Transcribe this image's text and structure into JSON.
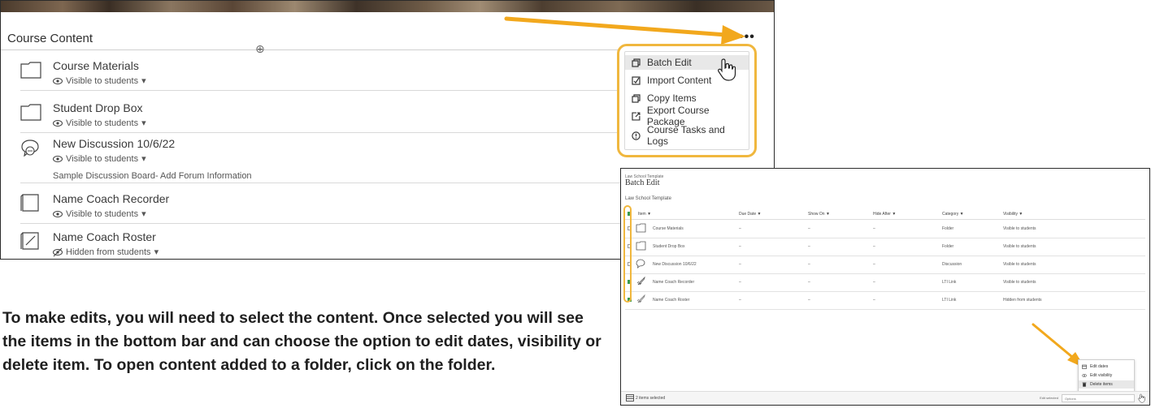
{
  "left": {
    "section_title": "Course Content",
    "items": [
      {
        "title": "Course Materials",
        "visibility": "Visible to students",
        "description": ""
      },
      {
        "title": "Student Drop Box",
        "visibility": "Visible to students",
        "description": ""
      },
      {
        "title": "New Discussion 10/6/22",
        "visibility": "Visible to students",
        "description": "Sample Discussion Board- Add Forum Information"
      },
      {
        "title": "Name Coach Recorder",
        "visibility": "Visible to students",
        "description": ""
      },
      {
        "title": "Name Coach Roster",
        "visibility": "Hidden from students",
        "description": ""
      }
    ],
    "menu": [
      {
        "label": "Batch Edit",
        "icon": "batch-edit-icon"
      },
      {
        "label": "Import Content",
        "icon": "import-icon"
      },
      {
        "label": "Copy Items",
        "icon": "copy-icon"
      },
      {
        "label": "Export Course Package",
        "icon": "export-icon"
      },
      {
        "label": "Course Tasks and Logs",
        "icon": "info-icon"
      }
    ],
    "more_label": "•••"
  },
  "right": {
    "crumb": "Law School Template",
    "title": "Batch Edit",
    "subtitle": "Law School Template",
    "columns": [
      "Item ▼",
      "Due Date ▼",
      "Show On ▼",
      "Hide After ▼",
      "Category ▼",
      "Visibility ▼"
    ],
    "rows": [
      {
        "item": "Course Materials",
        "due": "–",
        "show": "–",
        "hide": "–",
        "category": "Folder",
        "visibility": "Visible to students",
        "checked": false
      },
      {
        "item": "Student Drop Box",
        "due": "–",
        "show": "–",
        "hide": "–",
        "category": "Folder",
        "visibility": "Visible to students",
        "checked": false
      },
      {
        "item": "New Discussion 10/6/22",
        "due": "–",
        "show": "–",
        "hide": "–",
        "category": "Discussion",
        "visibility": "Visible to students",
        "checked": false
      },
      {
        "item": "Name Coach Recorder",
        "due": "–",
        "show": "–",
        "hide": "–",
        "category": "LTI Link",
        "visibility": "Visible to students",
        "checked": true
      },
      {
        "item": "Name Coach Roster",
        "due": "–",
        "show": "–",
        "hide": "–",
        "category": "LTI Link",
        "visibility": "Hidden from students",
        "checked": true
      }
    ],
    "selected_text": "2 items selected",
    "edit_label": "Edit selected",
    "select_placeholder": "Options",
    "options": [
      "Edit dates",
      "Edit visibility",
      "Delete items"
    ]
  },
  "instructions": "To make edits, you will need to select the content. Once selected you will see the items in the bottom bar and can choose the option to edit dates, visibility or delete item. To open content added to a folder, click on the folder.",
  "colors": {
    "highlight": "#f0b73e",
    "arrow": "#f2a81d",
    "check": "#3a9a4e"
  }
}
